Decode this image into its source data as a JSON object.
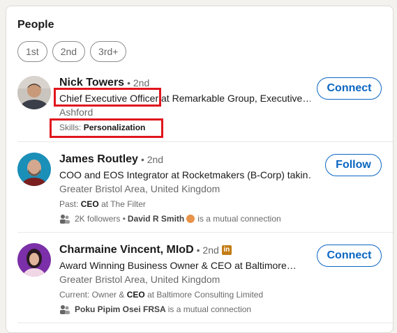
{
  "section_title": "People",
  "filters": [
    "1st",
    "2nd",
    "3rd+"
  ],
  "results": [
    {
      "name": "Nick Towers",
      "degree": "• 2nd",
      "headline": "Chief Executive Officer at Remarkable Group, Executive…",
      "location": "Ashford",
      "skills_label": "Skills:",
      "skills_value": "Personalization",
      "action": "Connect"
    },
    {
      "name": "James Routley",
      "degree": "• 2nd",
      "headline": "COO and EOS Integrator at Rocketmakers (B-Corp) takin…",
      "location": "Greater Bristol Area, United Kingdom",
      "past_label": "Past:",
      "past_role": "CEO",
      "past_company": "at The Filter",
      "followers": "2K followers •",
      "mutual_name": "David R Smith",
      "mutual_suffix": "is a mutual connection",
      "action": "Follow"
    },
    {
      "name": "Charmaine Vincent, MIoD",
      "degree": "• 2nd",
      "badge": "in",
      "headline": "Award Winning Business Owner & CEO at Baltimore…",
      "location": "Greater Bristol Area, United Kingdom",
      "current_label": "Current: Owner &",
      "current_role": "CEO",
      "current_company": "at Baltimore Consulting Limited",
      "mutual_name": "Poku Pipim Osei FRSA",
      "mutual_suffix": "is a mutual connection",
      "action": "Connect"
    }
  ],
  "colors": {
    "accent": "#0a66c2",
    "highlight": "#e0161d"
  }
}
